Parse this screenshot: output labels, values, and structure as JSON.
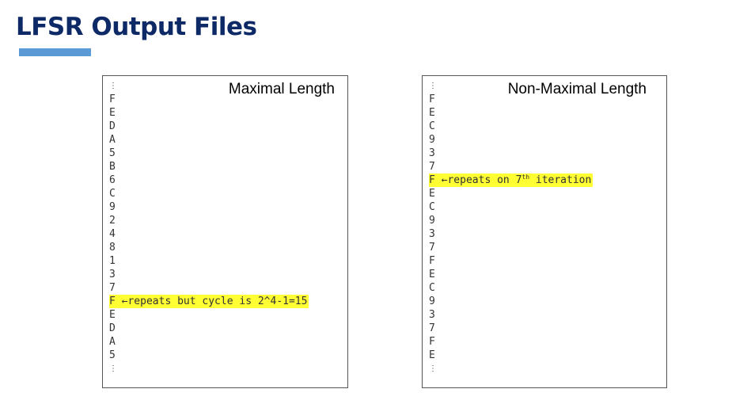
{
  "title": "LFSR Output Files",
  "left_panel": {
    "heading": "Maximal Length",
    "values": [
      "F",
      "E",
      "D",
      "A",
      "5",
      "B",
      "6",
      "C",
      "9",
      "2",
      "4",
      "8",
      "1",
      "3",
      "7"
    ],
    "repeat_value": "F",
    "repeat_note": "←repeats but cycle is 2^4-1=15",
    "after_values": [
      "E",
      "D",
      "A",
      "5"
    ],
    "ellipsis": "⋮"
  },
  "right_panel": {
    "heading": "Non-Maximal Length",
    "values": [
      "F",
      "E",
      "C",
      "9",
      "3",
      "7"
    ],
    "repeat_value": "F",
    "repeat_note_prefix": "←repeats on 7",
    "repeat_note_sup": "th",
    "repeat_note_suffix": " iteration",
    "after_values": [
      "E",
      "C",
      "9",
      "3",
      "7",
      "F",
      "E",
      "C",
      "9",
      "3",
      "7",
      "F",
      "E"
    ],
    "ellipsis": "⋮"
  },
  "colors": {
    "title": "#0d2a66",
    "accent_bar": "#5b9bd5",
    "highlight": "#ffff33"
  }
}
